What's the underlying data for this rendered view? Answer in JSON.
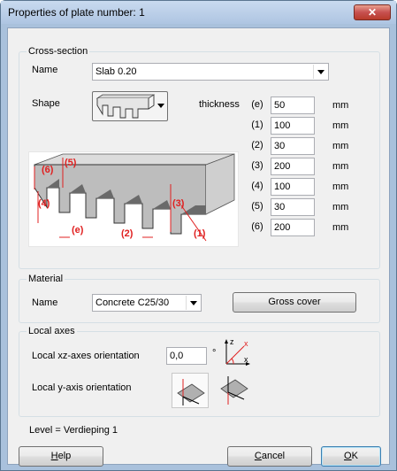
{
  "window": {
    "title": "Properties of plate number: 1",
    "close_glyph": "✕"
  },
  "cross_section": {
    "legend": "Cross-section",
    "name_label": "Name",
    "name_value": "Slab 0.20",
    "shape_label": "Shape",
    "thickness_label": "thickness",
    "unit": "mm",
    "params": [
      {
        "label": "(e)",
        "value": "50"
      },
      {
        "label": "(1)",
        "value": "100"
      },
      {
        "label": "(2)",
        "value": "30"
      },
      {
        "label": "(3)",
        "value": "200"
      },
      {
        "label": "(4)",
        "value": "100"
      },
      {
        "label": "(5)",
        "value": "30"
      },
      {
        "label": "(6)",
        "value": "200"
      }
    ],
    "diagram_labels": [
      "(6)",
      "(5)",
      "(4)",
      "(e)",
      "(2)",
      "(3)",
      "(1)"
    ]
  },
  "material": {
    "legend": "Material",
    "name_label": "Name",
    "name_value": "Concrete C25/30",
    "gross_cover_label": "Gross cover"
  },
  "local_axes": {
    "legend": "Local axes",
    "xz_label": "Local xz-axes orientation",
    "xz_value": "0,0",
    "degree_symbol": "°",
    "y_label": "Local y-axis orientation",
    "axis_letters": {
      "x": "x",
      "y": "y",
      "z": "z"
    }
  },
  "level_text": "Level = Verdieping 1",
  "buttons": {
    "help_mnemonic": "H",
    "help_rest": "elp",
    "cancel_mnemonic": "C",
    "cancel_rest": "ancel",
    "ok_mnemonic": "O",
    "ok_rest": "K"
  },
  "colors": {
    "dimension_red": "#e02020",
    "titlebar": "#b9cfe8",
    "dialog_bg": "#f0f0f0"
  }
}
